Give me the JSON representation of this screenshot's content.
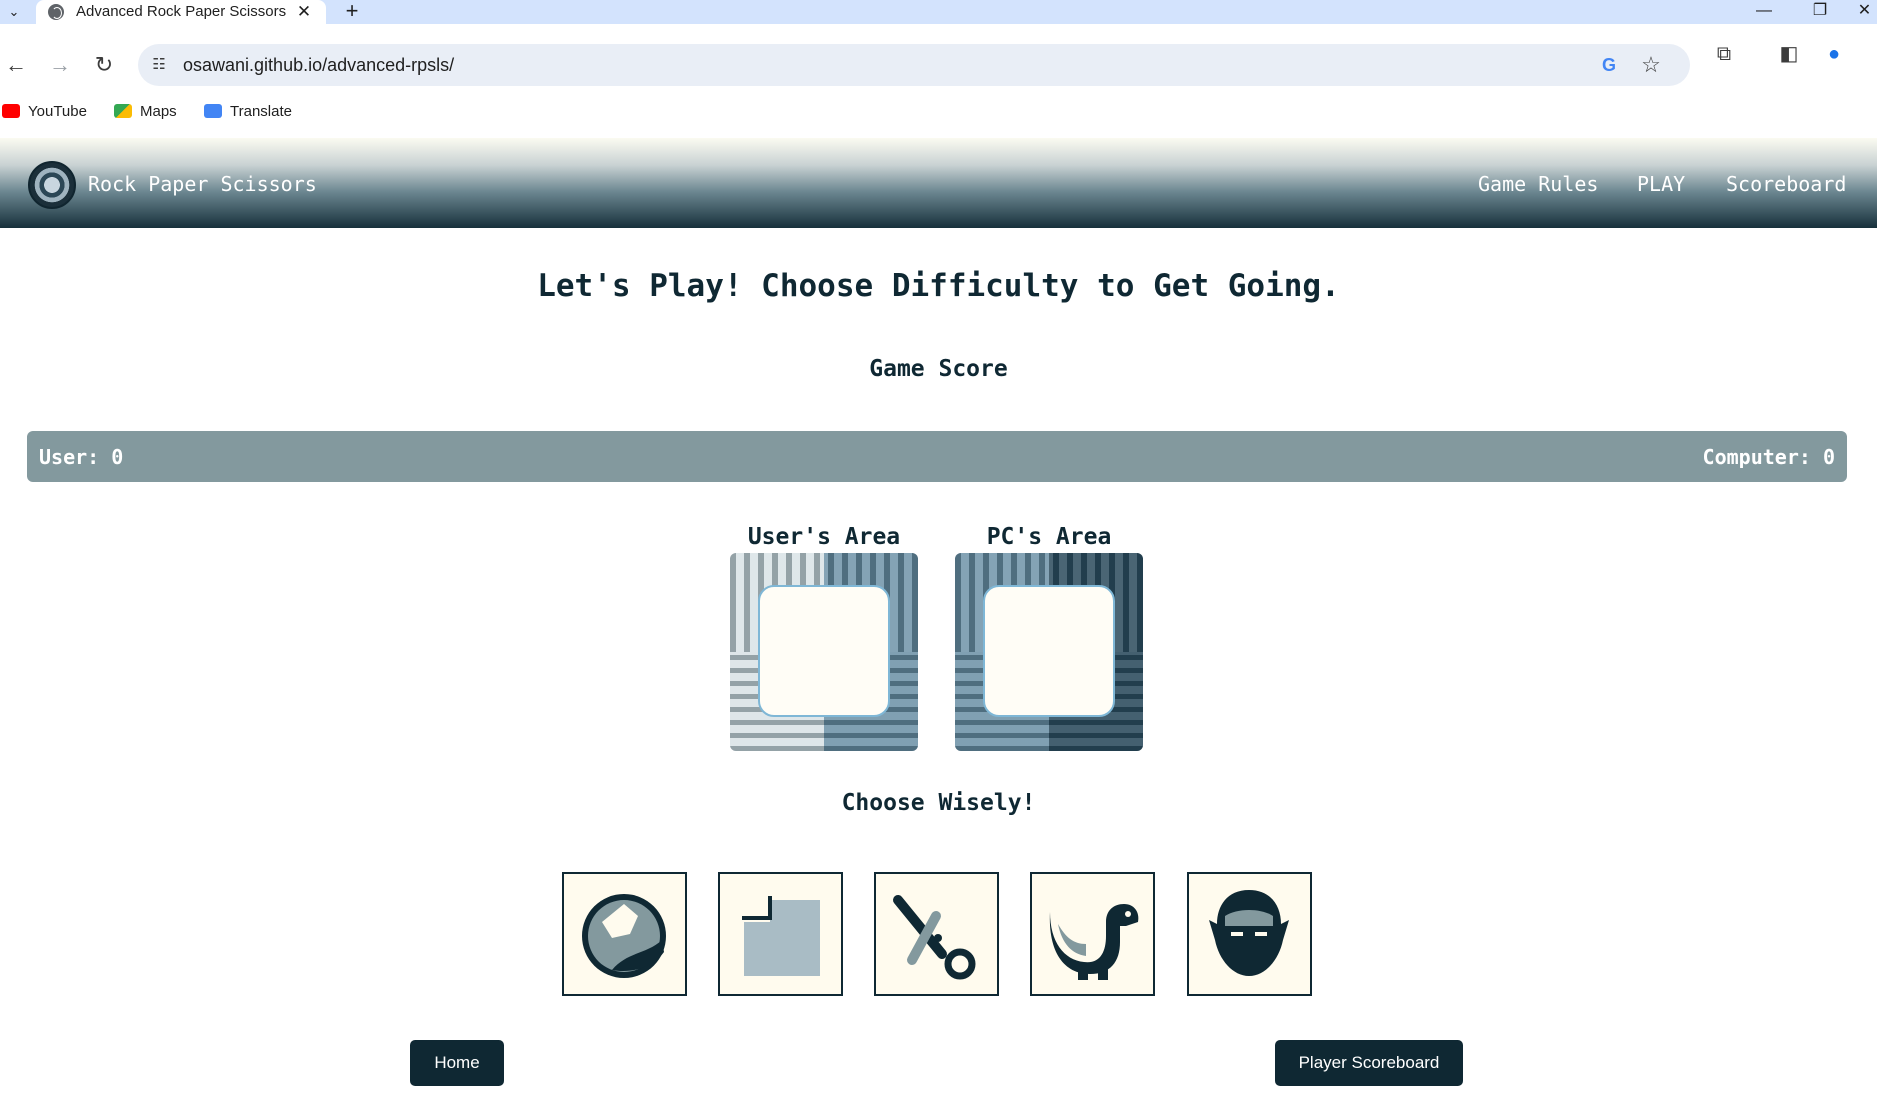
{
  "browser": {
    "tab_title": "Advanced Rock Paper Scissors",
    "url": "osawani.github.io/advanced-rpsls/",
    "bookmarks": [
      {
        "label": "YouTube",
        "icon": "youtube-icon"
      },
      {
        "label": "Maps",
        "icon": "maps-icon"
      },
      {
        "label": "Translate",
        "icon": "translate-icon"
      }
    ]
  },
  "site": {
    "brand": "Rock Paper Scissors",
    "nav": {
      "rules": "Game Rules",
      "play": "PLAY",
      "scoreboard": "Scoreboard"
    }
  },
  "main": {
    "headline": "Let's Play! Choose Difficulty to Get Going.",
    "score_heading": "Game Score",
    "user_score": "User: 0",
    "computer_score": "Computer: 0",
    "user_area": "User's Area",
    "pc_area": "PC's Area",
    "choose_heading": "Choose Wisely!",
    "choices": [
      "rock-icon",
      "paper-icon",
      "scissors-icon",
      "lizard-icon",
      "spock-icon"
    ]
  },
  "buttons": {
    "home": "Home",
    "player_scoreboard": "Player Scoreboard"
  },
  "colors": {
    "primary": "#0f2833",
    "score_bar": "#83999e",
    "choice_bg": "#fffbee",
    "area_border": "#7fb7d6"
  }
}
